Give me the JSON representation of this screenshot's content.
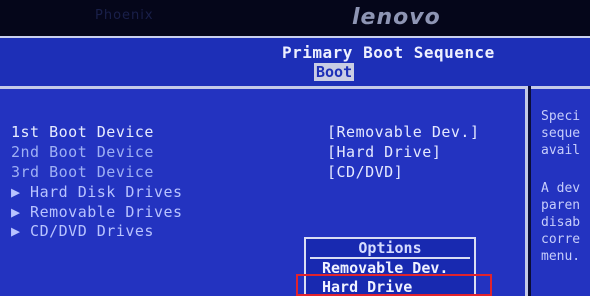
{
  "brand": {
    "logo_text": "lenovo",
    "ghost_text": "Phoenix"
  },
  "header": {
    "title": "Primary Boot Sequence",
    "tab": "Boot"
  },
  "boot_devices": [
    {
      "label": "1st Boot Device",
      "value": "[Removable Dev.]"
    },
    {
      "label": "2nd Boot Device",
      "value": "[Hard Drive]"
    },
    {
      "label": "3rd Boot Device",
      "value": "[CD/DVD]"
    }
  ],
  "submenus": [
    {
      "label": "▶ Hard Disk Drives"
    },
    {
      "label": "▶ Removable Drives"
    },
    {
      "label": "▶ CD/DVD Drives"
    }
  ],
  "help": {
    "lines": [
      "Speci",
      "seque",
      "avail",
      "",
      "A dev",
      "paren",
      "disab",
      "corre",
      "menu."
    ]
  },
  "options_popup": {
    "title": "Options",
    "items": [
      "Removable Dev.",
      "Hard Drive"
    ],
    "selected_index": 1
  },
  "colors": {
    "panel_blue": "#2333c0",
    "title_blue": "#1d2fb7",
    "highlight_red": "#e0232d"
  }
}
